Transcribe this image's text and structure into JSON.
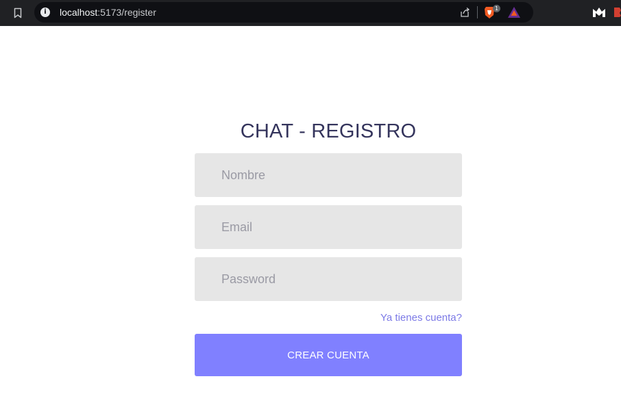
{
  "browser": {
    "url_host": "localhost",
    "url_path": ":5173/register",
    "extension_badge": "1",
    "info_icon": "info-icon",
    "colors": {
      "chrome_bg": "#202124",
      "url_bg": "#0f1014"
    }
  },
  "page": {
    "title": "CHAT - REGISTRO",
    "fields": {
      "name_placeholder": "Nombre",
      "email_placeholder": "Email",
      "password_placeholder": "Password"
    },
    "login_link": "Ya tienes cuenta?",
    "submit_label": "CREAR CUENTA",
    "colors": {
      "title": "#34345c",
      "field_bg": "#e6e6e6",
      "link": "#7b79e6",
      "button_bg": "#8080ff",
      "button_text": "#ffffff"
    }
  }
}
